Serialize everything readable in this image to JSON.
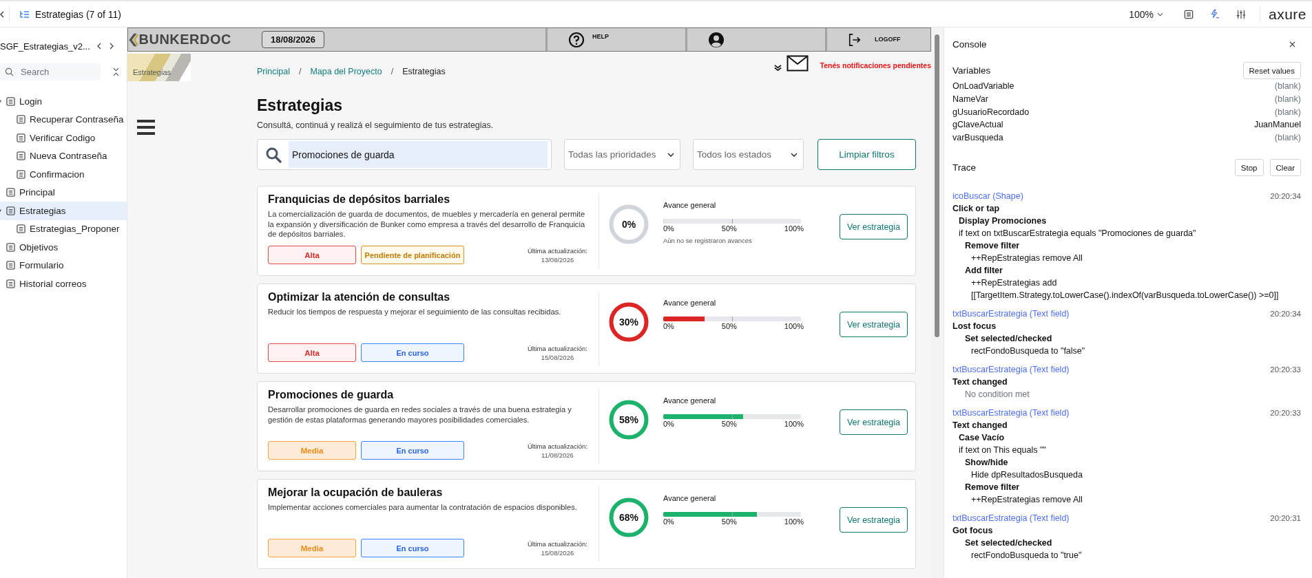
{
  "toolbar": {
    "title": "Estrategias (7 of 11)",
    "zoom": "100%",
    "brand": "axure",
    "buttons": [
      {
        "kind": "notes",
        "selected": false
      },
      {
        "kind": "console",
        "selected": true
      },
      {
        "kind": "adjust",
        "selected": false
      }
    ]
  },
  "sidebar": {
    "project": "SGF_Estrategias_v2...",
    "search": {
      "placeholder": "Search"
    },
    "pages": [
      {
        "label": "Login",
        "selected": false,
        "expanded": true,
        "children": [
          {
            "label": "Recuperar Contraseña",
            "selected": false
          },
          {
            "label": "Verificar Codigo",
            "selected": false
          },
          {
            "label": "Nueva Contraseña",
            "selected": false
          },
          {
            "label": "Confirmacion",
            "selected": false
          }
        ]
      },
      {
        "label": "Principal",
        "selected": false,
        "expanded": false
      },
      {
        "label": "Estrategias",
        "selected": true,
        "expanded": true,
        "children": [
          {
            "label": "Estrategias_Proponer",
            "selected": false
          }
        ]
      },
      {
        "label": "Objetivos",
        "selected": false,
        "expanded": false
      },
      {
        "label": "Formulario",
        "selected": false,
        "expanded": false
      },
      {
        "label": "Historial correos",
        "selected": false,
        "expanded": false
      }
    ]
  },
  "prototype": {
    "header": {
      "logo": "BUNKERDOC",
      "date": "18/08/2026",
      "help": "HELP",
      "logoff": "LOGOFF"
    },
    "section_tag": "Estrategias",
    "breadcrumb": [
      {
        "label": "Principal",
        "current": false
      },
      {
        "label": "/",
        "kind": "separator"
      },
      {
        "label": "Mapa del Proyecto",
        "current": false
      },
      {
        "label": "/",
        "kind": "separator"
      },
      {
        "label": "Estrategias",
        "current": true
      }
    ],
    "notification": "Tenés notificaciones pendientes",
    "title": "Estrategias",
    "subtitle": "Consultá, continuá y realizá el seguimiento de tus estrategias.",
    "filters": {
      "search": "Promociones de guarda",
      "priority": "Todas las prioridades",
      "status": "Todos los estados",
      "clear": "Limpiar filtros"
    },
    "strategies": [
      {
        "title": "Franquicias de depósitos barriales",
        "description": "La comercialización de guarda de documentos, de muebles y mercadería en general permite la expansión y diversificación de Bunker como empresa a través del desarrollo de Franquicia de depósitos barriales.",
        "priority": {
          "label": "Alta",
          "kind": "high"
        },
        "status": {
          "label": "Pendiente de planificación",
          "kind": "pending"
        },
        "updated_label": "Última actualización:",
        "updated_date": "13/08/2026",
        "percent": "0%",
        "color": "#d1d5db",
        "progress_label": "Avance general",
        "level": 0,
        "scale": [
          "0%",
          "50%",
          "100%"
        ],
        "note": "Aún no se registraron avances",
        "button": "Ver estrategia"
      },
      {
        "title": "Optimizar la atención de consultas",
        "description": "Reducir los tiempos de respuesta y mejorar el seguimiento de las consultas recibidas.",
        "priority": {
          "label": "Alta",
          "kind": "high"
        },
        "status": {
          "label": "En curso",
          "kind": "in_progress"
        },
        "updated_label": "Última actualización:",
        "updated_date": "15/08/2026",
        "percent": "30%",
        "color": "#dc2626",
        "progress_label": "Avance general",
        "level": 0.3,
        "scale": [
          "0%",
          "50%",
          "100%"
        ],
        "button": "Ver estrategia"
      },
      {
        "title": "Promociones de guarda",
        "description": "Desarrollar promociones de guarda en redes sociales a través de una buena estrategia y gestión de estas plataformas generando mayores posibilidades comerciales.",
        "priority": {
          "label": "Media",
          "kind": "medium"
        },
        "status": {
          "label": "En curso",
          "kind": "in_progress"
        },
        "updated_label": "Última actualización:",
        "updated_date": "11/08/2026",
        "percent": "58%",
        "color": "#1db26b",
        "progress_label": "Avance general",
        "level": 0.58,
        "scale": [
          "0%",
          "50%",
          "100%"
        ],
        "button": "Ver estrategia"
      },
      {
        "title": "Mejorar la ocupación de bauleras",
        "description": "Implementar acciones comerciales para aumentar la contratación de espacios disponibles.",
        "priority": {
          "label": "Media",
          "kind": "medium"
        },
        "status": {
          "label": "En curso",
          "kind": "in_progress"
        },
        "updated_label": "Última actualización:",
        "updated_date": "15/08/2026",
        "percent": "68%",
        "color": "#1db26b",
        "progress_label": "Avance general",
        "level": 0.68,
        "scale": [
          "0%",
          "50%",
          "100%"
        ],
        "button": "Ver estrategia"
      }
    ]
  },
  "console": {
    "title": "Console",
    "variables_title": "Variables",
    "reset": "Reset values",
    "variables": [
      {
        "name": "OnLoadVariable",
        "value": "(blank)",
        "kind": "blank"
      },
      {
        "name": "NameVar",
        "value": "(blank)",
        "kind": "blank"
      },
      {
        "name": "gUsuarioRecordado",
        "value": "(blank)",
        "kind": "blank"
      },
      {
        "name": "gClaveActual",
        "value": "JuanManuel",
        "kind": "set"
      },
      {
        "name": "varBusqueda",
        "value": "(blank)",
        "kind": "blank"
      }
    ],
    "trace_title": "Trace",
    "stop": "Stop",
    "clear": "Clear",
    "trace": [
      {
        "source": "icoBuscar (Shape)",
        "time": "20:20:34",
        "lines": [
          {
            "kind": "event",
            "text": "Click or tap",
            "children": [
              {
                "kind": "case",
                "text": "Display Promociones"
              },
              {
                "kind": "condition",
                "text": "if text on txtBuscarEstrategia equals \"Promociones de guarda\"",
                "children": [
                  {
                    "kind": "action",
                    "text": "Remove filter",
                    "children": [
                      {
                        "kind": "target",
                        "text": "++RepEstrategias remove All"
                      }
                    ]
                  },
                  {
                    "kind": "action",
                    "text": "Add filter",
                    "children": [
                      {
                        "kind": "target",
                        "text": "++RepEstrategias add"
                      },
                      {
                        "kind": "target",
                        "text": "[[TargetItem.Strategy.toLowerCase().indexOf(varBusqueda.toLowerCase()) >=0]]"
                      }
                    ]
                  }
                ]
              }
            ]
          }
        ]
      },
      {
        "source": "txtBuscarEstrategia (Text field)",
        "time": "20:20:34",
        "lines": [
          {
            "kind": "event",
            "text": "Lost focus",
            "children": [
              {
                "kind": "action",
                "text": "Set selected/checked",
                "children": [
                  {
                    "kind": "target",
                    "text": "rectFondoBusqueda to \"false\""
                  }
                ]
              }
            ]
          }
        ]
      },
      {
        "source": "txtBuscarEstrategia (Text field)",
        "time": "20:20:33",
        "lines": [
          {
            "kind": "event",
            "text": "Text changed",
            "children": [
              {
                "kind": "note",
                "text": "No condition met"
              }
            ]
          }
        ]
      },
      {
        "source": "txtBuscarEstrategia (Text field)",
        "time": "20:20:33",
        "lines": [
          {
            "kind": "event",
            "text": "Text changed",
            "children": [
              {
                "kind": "case",
                "text": "Case Vacío"
              },
              {
                "kind": "condition",
                "text": "if text on This equals \"\"",
                "children": [
                  {
                    "kind": "action",
                    "text": "Show/hide",
                    "children": [
                      {
                        "kind": "target",
                        "text": "Hide dpResultadosBusqueda"
                      }
                    ]
                  },
                  {
                    "kind": "action",
                    "text": "Remove filter",
                    "children": [
                      {
                        "kind": "target",
                        "text": "++RepEstrategias remove All"
                      }
                    ]
                  }
                ]
              }
            ]
          }
        ]
      },
      {
        "source": "txtBuscarEstrategia (Text field)",
        "time": "20:20:31",
        "lines": [
          {
            "kind": "event",
            "text": "Got focus",
            "children": [
              {
                "kind": "action",
                "text": "Set selected/checked",
                "children": [
                  {
                    "kind": "target",
                    "text": "rectFondoBusqueda to \"true\""
                  }
                ]
              }
            ]
          }
        ]
      }
    ]
  }
}
